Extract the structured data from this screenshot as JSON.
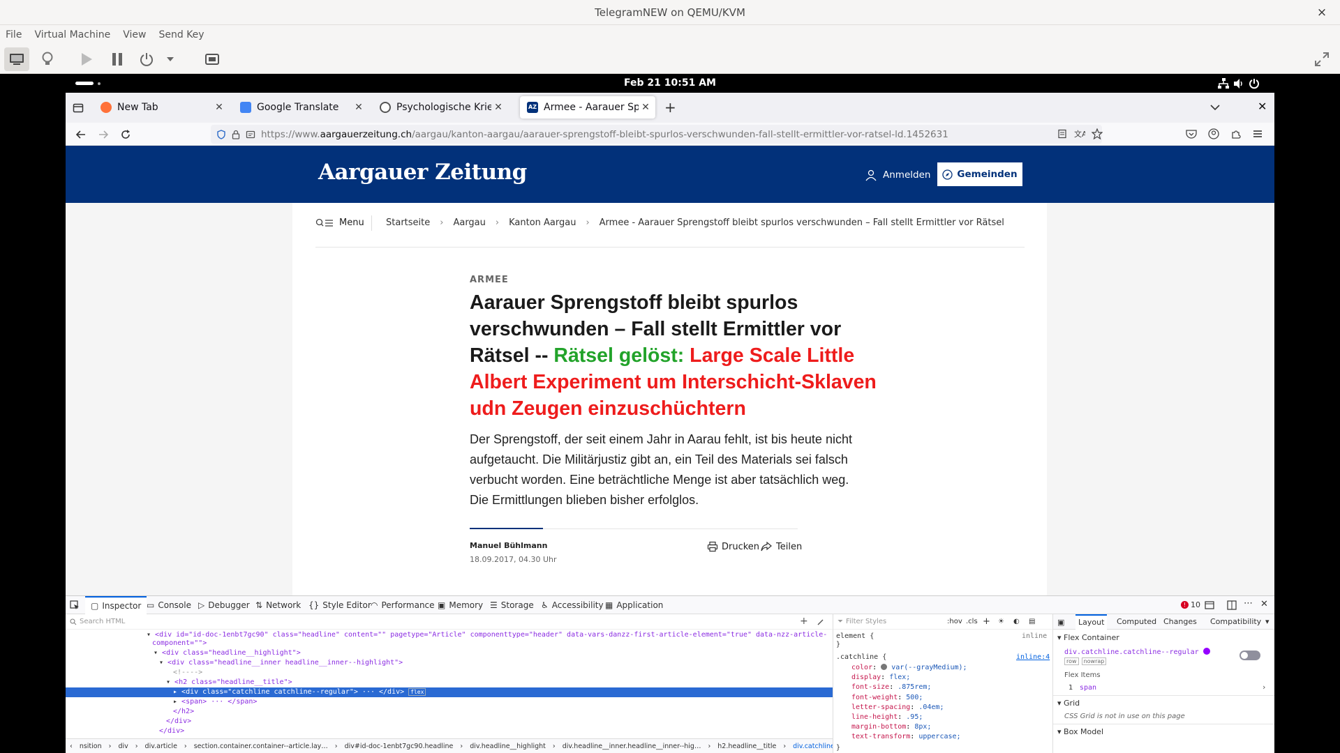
{
  "window": {
    "title": "TelegramNEW on QEMU/KVM",
    "close": "×"
  },
  "menu": [
    "File",
    "Virtual Machine",
    "View",
    "Send Key"
  ],
  "gnome": {
    "clock": "Feb 21  10:51 AM"
  },
  "tabs": [
    {
      "label": "New Tab",
      "icon": "firefox-icon",
      "color": "#ff7139"
    },
    {
      "label": "Google Translate",
      "icon": "translate-icon",
      "color": "#4285f4"
    },
    {
      "label": "Psychologische Kriegsfüh",
      "icon": "globe-icon",
      "color": "#555555"
    },
    {
      "label": "Armee - Aarauer Sprengs",
      "icon": "az-icon",
      "color": "#02317a"
    }
  ],
  "url": {
    "prefix": "https://www.",
    "domain": "aargauerzeitung.ch",
    "path": "/aargau/kanton-aargau/aarauer-sprengstoff-bleibt-spurlos-verschwunden-fall-stellt-ermittler-vor-ratsel-ld.1452631"
  },
  "site": {
    "logo": "Aargauer Zeitung",
    "login": "Anmelden",
    "communities": "Gemeinden",
    "menu": "Menu",
    "breadcrumbs": [
      "Startseite",
      "Aargau",
      "Kanton Aargau",
      "Armee - Aarauer Sprengstoff bleibt spurlos verschwunden – Fall stellt Ermittler vor Rätsel"
    ]
  },
  "article": {
    "catchline": "ARMEE",
    "headline_black": "Aarauer Sprengstoff bleibt spurlos verschwunden – Fall stellt Ermittler vor Rätsel -- ",
    "headline_green": "Rätsel gelöst: ",
    "headline_red": "Large Scale Little Albert Experiment um Interschicht-Sklaven udn Zeugen einzuschüchtern",
    "lead": "Der Sprengstoff, der seit einem Jahr in Aarau fehlt, ist bis heute nicht aufgetaucht. Die Militärjustiz gibt an, ein Teil des Materials sei falsch verbucht worden. Eine beträchtliche Menge ist aber tatsächlich weg. Die Ermittlungen blieben bisher erfolglos.",
    "author": "Manuel Bühlmann",
    "date": "18.09.2017, 04.30 Uhr",
    "print": "Drucken",
    "share": "Teilen"
  },
  "devtools": {
    "tabs": [
      "Inspector",
      "Console",
      "Debugger",
      "Network",
      "Style Editor",
      "Performance",
      "Memory",
      "Storage",
      "Accessibility",
      "Application"
    ],
    "error_count": "10",
    "search_placeholder": "Search HTML",
    "filter_placeholder": "Filter Styles",
    "hov": ":hov",
    "cls": ".cls",
    "layout_tabs": [
      "Layout",
      "Computed",
      "Changes",
      "Compatibility"
    ],
    "markup_lines": [
      "<div id=\"id-doc-1enbt7gc90\" class=\"headline\" content=\"\" pagetype=\"Article\" componenttype=\"header\" data-vars-danzz-first-article-element=\"true\" data-nzz-article-",
      "component=\"\">",
      "<div class=\"headline__highlight\">",
      "<div class=\"headline__inner headline__inner--highlight\">",
      "<!---->",
      "<h2 class=\"headline__title\">",
      "<div class=\"catchline catchline--regular\"> ··· </div>",
      "<span> ··· </span>",
      "</h2>",
      "</div>",
      "</div>"
    ],
    "flex_badge": "flex",
    "breadcrumb": [
      "nsition",
      "div",
      "div.article",
      "section.container.container--article.lay…",
      "div#id-doc-1enbt7gc90.headline",
      "div.headline__highlight",
      "div.headline__inner.headline__inner--hig…",
      "h2.headline__title",
      "div.catchline.catchline--regular"
    ],
    "rules": {
      "element_selector": "element",
      "element_brace": "{",
      "close_brace": "}",
      "inline": "inline",
      "selector": ".catchline",
      "source": "inline:4",
      "props": [
        [
          "color",
          "var(--grayMedium);"
        ],
        [
          "display",
          "flex;"
        ],
        [
          "font-size",
          ".875rem;"
        ],
        [
          "font-weight",
          "500;"
        ],
        [
          "letter-spacing",
          ".04em;"
        ],
        [
          "line-height",
          ".95;"
        ],
        [
          "margin-bottom",
          "8px;"
        ],
        [
          "text-transform",
          "uppercase;"
        ]
      ]
    },
    "layout": {
      "flex_container": "Flex Container",
      "flex_element": "div.catchline.catchline--regular",
      "badges": [
        "row",
        "nowrap"
      ],
      "flex_items": "Flex Items",
      "item_index": "1",
      "item_name": "span",
      "grid": "Grid",
      "grid_note": "CSS Grid is not in use on this page",
      "box_model": "Box Model"
    }
  }
}
